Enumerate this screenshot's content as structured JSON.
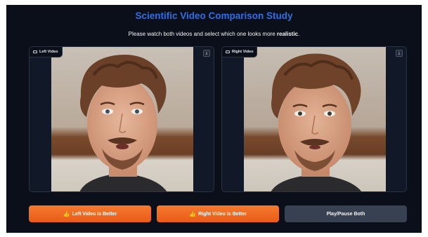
{
  "page": {
    "title": "Scientific Video Comparison Study",
    "instruction_prefix": "Please watch both videos and select which one looks more ",
    "instruction_emphasis": "realistic",
    "instruction_suffix": "."
  },
  "videos": [
    {
      "label": "Left Video",
      "icon": "video-camera-icon"
    },
    {
      "label": "Right Video",
      "icon": "video-camera-icon"
    }
  ],
  "buttons": {
    "left_better": {
      "icon": "thumbs-up-icon",
      "label": "Left Video is Better"
    },
    "right_better": {
      "icon": "thumbs-up-icon",
      "label": "Right Video is Better"
    },
    "play_pause": {
      "label": "Play/Pause Both"
    }
  },
  "colors": {
    "background": "#0b0f19",
    "title": "#2f6fe4",
    "orange_button": "#ea5b17",
    "gray_button": "#374151"
  }
}
